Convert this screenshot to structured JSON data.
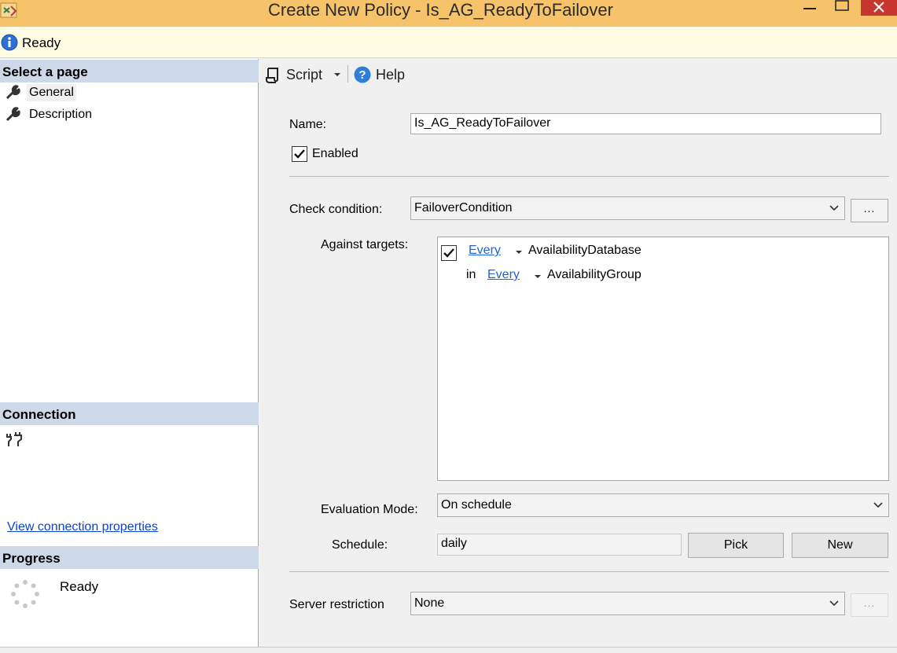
{
  "window": {
    "title": "Create New Policy - Is_AG_ReadyToFailover"
  },
  "status": {
    "text": "Ready"
  },
  "left_panel": {
    "select_page_header": "Select a page",
    "pages": [
      {
        "label": "General",
        "selected": true
      },
      {
        "label": "Description",
        "selected": false
      }
    ],
    "connection_header": "Connection",
    "view_connection_link": "View connection properties",
    "progress_header": "Progress",
    "progress_text": "Ready"
  },
  "toolbar": {
    "script_label": "Script",
    "help_label": "Help"
  },
  "form": {
    "name_label": "Name:",
    "name_value": "Is_AG_ReadyToFailover",
    "enabled_label": "Enabled",
    "enabled_checked": true,
    "check_condition_label": "Check condition:",
    "check_condition_value": "FailoverCondition",
    "ellipsis_label": "...",
    "against_targets_label": "Against targets:",
    "targets": {
      "row1": {
        "checked": true,
        "quantifier": "Every",
        "object": "AvailabilityDatabase"
      },
      "row2": {
        "prefix": "in",
        "quantifier": "Every",
        "object": "AvailabilityGroup"
      }
    },
    "evaluation_mode_label": "Evaluation Mode:",
    "evaluation_mode_value": "On schedule",
    "schedule_label": "Schedule:",
    "schedule_value": "daily",
    "pick_label": "Pick",
    "new_label": "New",
    "server_restriction_label": "Server restriction",
    "server_restriction_value": "None"
  },
  "colors": {
    "titlebar": "#f6c36b",
    "statusbar": "#fffde3",
    "section_header": "#cdd9e8",
    "link": "#1f63d8",
    "close_button": "#c7372f"
  },
  "icons": [
    "app-icon",
    "minimize-icon",
    "maximize-icon",
    "close-icon",
    "info-icon",
    "wrench-icon",
    "plug-icon",
    "spinner-icon",
    "script-icon",
    "help-icon",
    "chevron-down-icon",
    "dropdown-arrow-icon",
    "checkmark-icon"
  ]
}
